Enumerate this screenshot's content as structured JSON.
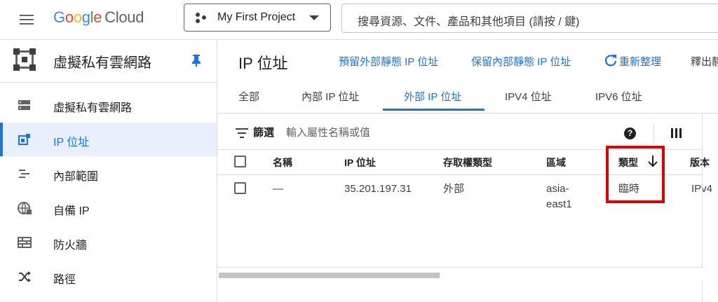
{
  "topbar": {
    "logo_google_letters": [
      "G",
      "o",
      "o",
      "g",
      "l",
      "e"
    ],
    "logo_cloud": "Cloud",
    "project_name": "My First Project",
    "search_placeholder": "搜尋資源、文件、產品和其他項目 (請按 / 鍵)"
  },
  "sidebar": {
    "title": "虛擬私有雲網路",
    "items": [
      {
        "label": "虛擬私有雲網路",
        "icon": "vpc-network-icon",
        "active": false
      },
      {
        "label": "IP 位址",
        "icon": "ip-address-icon",
        "active": true
      },
      {
        "label": "內部範圍",
        "icon": "internal-range-icon",
        "active": false
      },
      {
        "label": "自備 IP",
        "icon": "byoip-globe-icon",
        "active": false
      },
      {
        "label": "防火牆",
        "icon": "firewall-icon",
        "active": false
      },
      {
        "label": "路徑",
        "icon": "routes-icon",
        "active": false
      }
    ]
  },
  "main": {
    "title": "IP 位址",
    "actions": {
      "reserve_external": "預留外部靜態 IP 位址",
      "reserve_internal": "保留內部靜態 IP 位址",
      "refresh": "重新整理",
      "release": "釋出靜"
    },
    "tabs": [
      {
        "label": "全部",
        "active": false
      },
      {
        "label": "內部 IP 位址",
        "active": false
      },
      {
        "label": "外部 IP 位址",
        "active": true
      },
      {
        "label": "IPV4 位址",
        "active": false
      },
      {
        "label": "IPV6 位址",
        "active": false
      }
    ],
    "filter": {
      "label": "篩選",
      "placeholder": "輸入屬性名稱或值"
    },
    "table": {
      "columns": [
        "名稱",
        "IP 位址",
        "存取權類型",
        "區域",
        "類型",
        "版本"
      ],
      "rows": [
        {
          "name": "—",
          "ip": "35.201.197.31",
          "access_type": "外部",
          "region_line1": "asia-",
          "region_line2": "east1",
          "type": "臨時",
          "version": "IPv4"
        }
      ]
    }
  },
  "colors": {
    "accent": "#1a73e8",
    "active_bg": "#e8f0fe",
    "highlight_box": "#e00000"
  }
}
